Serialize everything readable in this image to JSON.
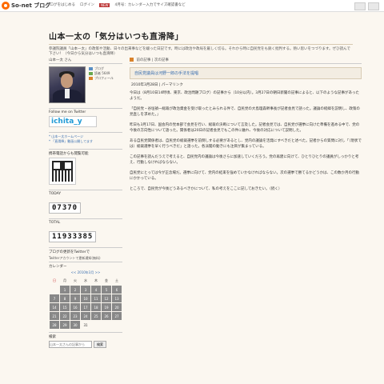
{
  "topbar": {
    "logo": "So-net ブログ",
    "links": [
      "ブログをはじめる",
      "ログイン",
      "ぶらり"
    ],
    "badge": "NEW",
    "promo": "4月号：カレンダー入力でサイズ確認書など"
  },
  "blog": {
    "title": "山本一太の「気分はいつも直滑降」",
    "description": "参議院議員「山本一太」の政策や活動、日々の出来事などを綴った日記です。時には政治や政局を厳しく切る。それから時に自民党をも鋭く批判する。熱い思いをつづります。ぜひ読んで下さい！（今日から気分はいつも直滑降）"
  },
  "sidebar": {
    "profile_title": "山本一太 さん",
    "profile_meta": [
      {
        "icon": "blog-icon",
        "text": "ブログ"
      },
      {
        "icon": "comment-icon",
        "text": "読者 5649"
      },
      {
        "icon": "mail-icon",
        "text": "プロフィール"
      }
    ],
    "follow_title": "Follow me on Twitter",
    "twitter_badge": "ichita_y",
    "links": [
      "* 山本一太ホームページ",
      "* 「直滑降」動画公開してます"
    ],
    "mobile_title": "携帯電話からも閲覧可能",
    "today_label": "TODAY",
    "today_value": "07370",
    "total_label": "TOTAL",
    "total_value": "11933385",
    "search_note_title": "ブログの更新をTwitterで",
    "search_note": "Twitterアカウントで更新通知(無料)",
    "calendar_title": "カレンダー",
    "calendar_nav": "<< 2010年3月 >>",
    "calendar_head": [
      "日",
      "月",
      "火",
      "水",
      "木",
      "金",
      "土"
    ],
    "calendar_rows": [
      [
        "",
        "1",
        "2",
        "3",
        "4",
        "5",
        "6"
      ],
      [
        "7",
        "8",
        "9",
        "10",
        "11",
        "12",
        "13"
      ],
      [
        "14",
        "15",
        "16",
        "17",
        "18",
        "19",
        "20"
      ],
      [
        "21",
        "22",
        "23",
        "24",
        "25",
        "26",
        "27"
      ],
      [
        "28",
        "29",
        "30",
        "31",
        "",
        "",
        ""
      ]
    ],
    "search_title": "検索",
    "search_placeholder": "山本一太さんの記事から",
    "search_button": "検索"
  },
  "main": {
    "crumb": "前の記事 | 次の記事",
    "post_title": "自民党議員は河野一郎の手法を提唱",
    "post_date": "2010年3月28日 | パーマリンク",
    "paragraphs": [
      "今日は（8月10日14時頃、東京、政治問題ブログ）の記事から（10分以内）。3月27日の朝日新聞の記事によると、以下のような記事があったようだ。",
      "「自民党・谷垣禎一総裁が政治資金を受け取ったとみられる件で、自民党の大島理森幹事長が記者会見で語った。議論の経緯を説明し、政策の見直しを求めた。」",
      "昨日も3月17日、国会内の党本部で会見を行い、総裁の決断について言及した。記者会見では、自民党が選挙に向けた準備を進める中で、党の今後の方向性について語った。関係者は20日の記者会見でもこの件に触れ、今後の対応について説明した。",
      "ある自民党関係者は、自民党の総裁選挙を前倒しする必要があるとし、党内の議論を活発にすべきだと述べた。記者からの質問に対し「（現状では）総裁選挙を早く行うべきだ」と語った。各派閥の動きにも注目が集まっている。",
      "この記事を読んだうえで考えると、自民党内の議論は今後さらに加速していくだろう。党の再建に向けて、ひとりひとりの議員がしっかりと考え、行動しなければならない。",
      "自民党にとっては今が正念場だ。選挙に向けて、党内の結束を強めていかなければならない。次の選挙で勝てるかどうかは、この数か月の行動にかかっている。",
      "ところで、自民党が今後どうあるべきかについて、私の考えをここに記しておきたい。（続く）"
    ]
  }
}
